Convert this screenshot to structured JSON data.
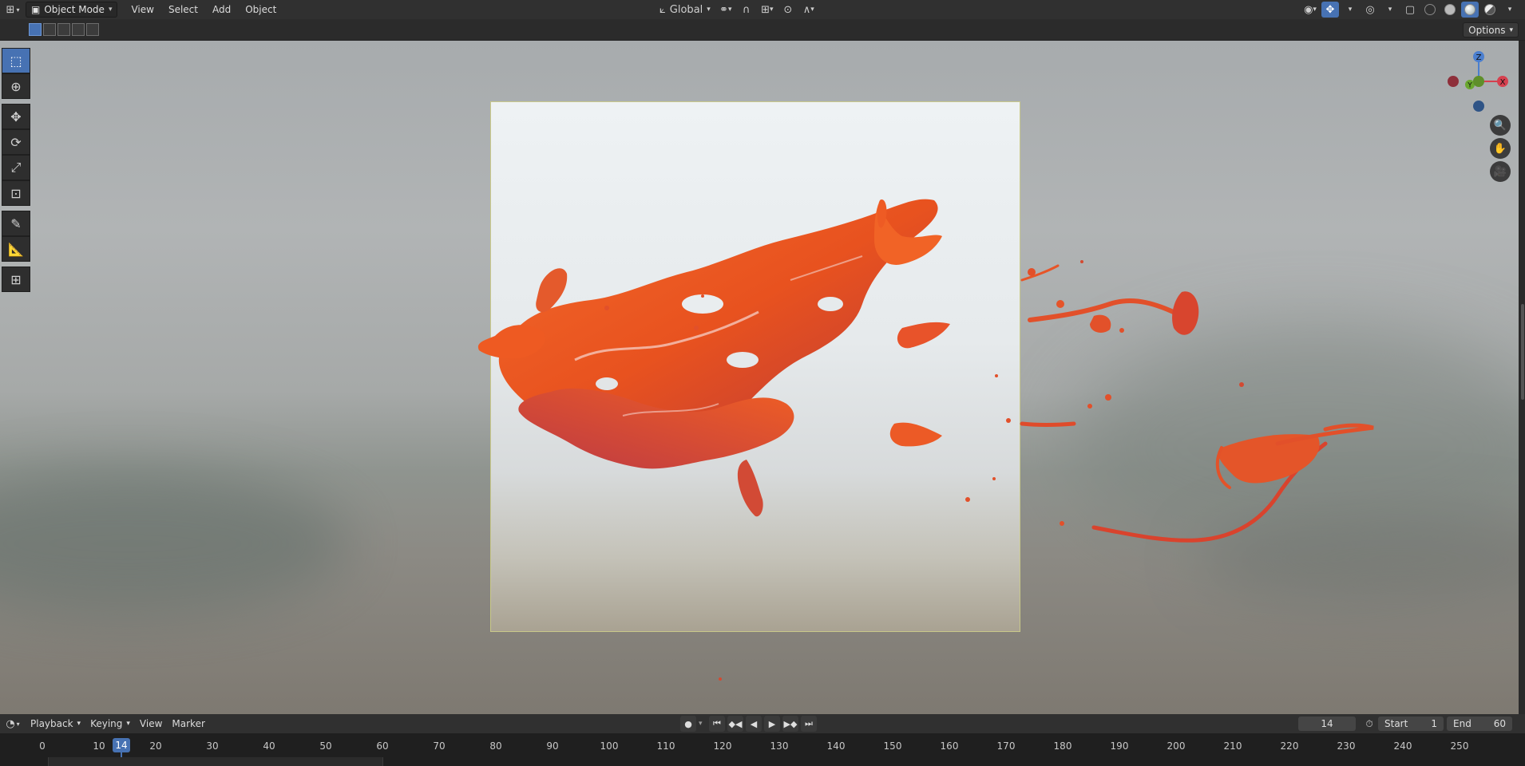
{
  "header": {
    "editor_type_icon": "editor-type-icon",
    "mode_label": "Object Mode",
    "menus": [
      "View",
      "Select",
      "Add",
      "Object"
    ],
    "orientation_label": "Global"
  },
  "toolstrip": {
    "options_label": "Options"
  },
  "viewport": {
    "toolbar_tools": [
      "select-box",
      "cursor",
      "move",
      "rotate",
      "scale",
      "transform",
      "annotate",
      "measure",
      "add-cube"
    ],
    "gizmo_axes": [
      "Z",
      "Y",
      "X"
    ]
  },
  "timeline": {
    "menus": [
      "Playback",
      "Keying",
      "View",
      "Marker"
    ],
    "current_frame": "14",
    "start_label": "Start",
    "start_value": "1",
    "end_label": "End",
    "end_value": "60",
    "ruler_ticks": [
      "0",
      "10",
      "20",
      "30",
      "40",
      "50",
      "60",
      "70",
      "80",
      "90",
      "100",
      "110",
      "120",
      "130",
      "140",
      "150",
      "160",
      "170",
      "180",
      "190",
      "200",
      "210",
      "220",
      "230",
      "240",
      "250"
    ],
    "playhead_label": "14"
  },
  "colors": {
    "accent": "#4772b3",
    "splash_orange": "#f05a20",
    "splash_red": "#c23a3a"
  }
}
